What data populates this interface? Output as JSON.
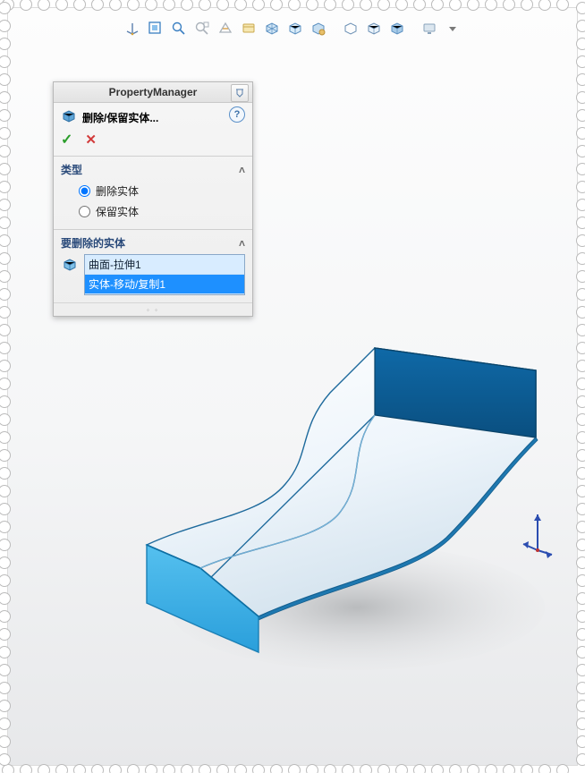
{
  "toolbar": {
    "icons": [
      "triad-icon",
      "zoom-window-icon",
      "zoom-fit-icon",
      "zoom-area-icon",
      "section-icon",
      "appearance-icon",
      "view-settings-icon",
      "iso-icon",
      "view-selector-icon",
      "display-style-icon",
      "hlr-icon",
      "shaded-icon",
      "monitor-icon",
      "dropdown-icon"
    ]
  },
  "pm": {
    "title": "PropertyManager",
    "feature_name": "删除/保留实体...",
    "help_char": "?",
    "ok_char": "✓",
    "cancel_char": "✕",
    "sections": {
      "type": {
        "title": "类型",
        "radios": [
          {
            "label": "删除实体",
            "checked": true
          },
          {
            "label": "保留实体",
            "checked": false
          }
        ]
      },
      "bodies": {
        "title": "要删除的实体",
        "items": [
          {
            "label": "曲面-拉伸1",
            "selected": false
          },
          {
            "label": "实体-移动/复制1",
            "selected": true
          }
        ]
      }
    }
  },
  "colors": {
    "face_dark": "#0e5e98",
    "face_light": "#38aee8",
    "surface_top": "#f5fbff",
    "surface_shade": "#d6e5ef",
    "outline": "#1e5f8e",
    "shadow": "#c5c6c8"
  }
}
